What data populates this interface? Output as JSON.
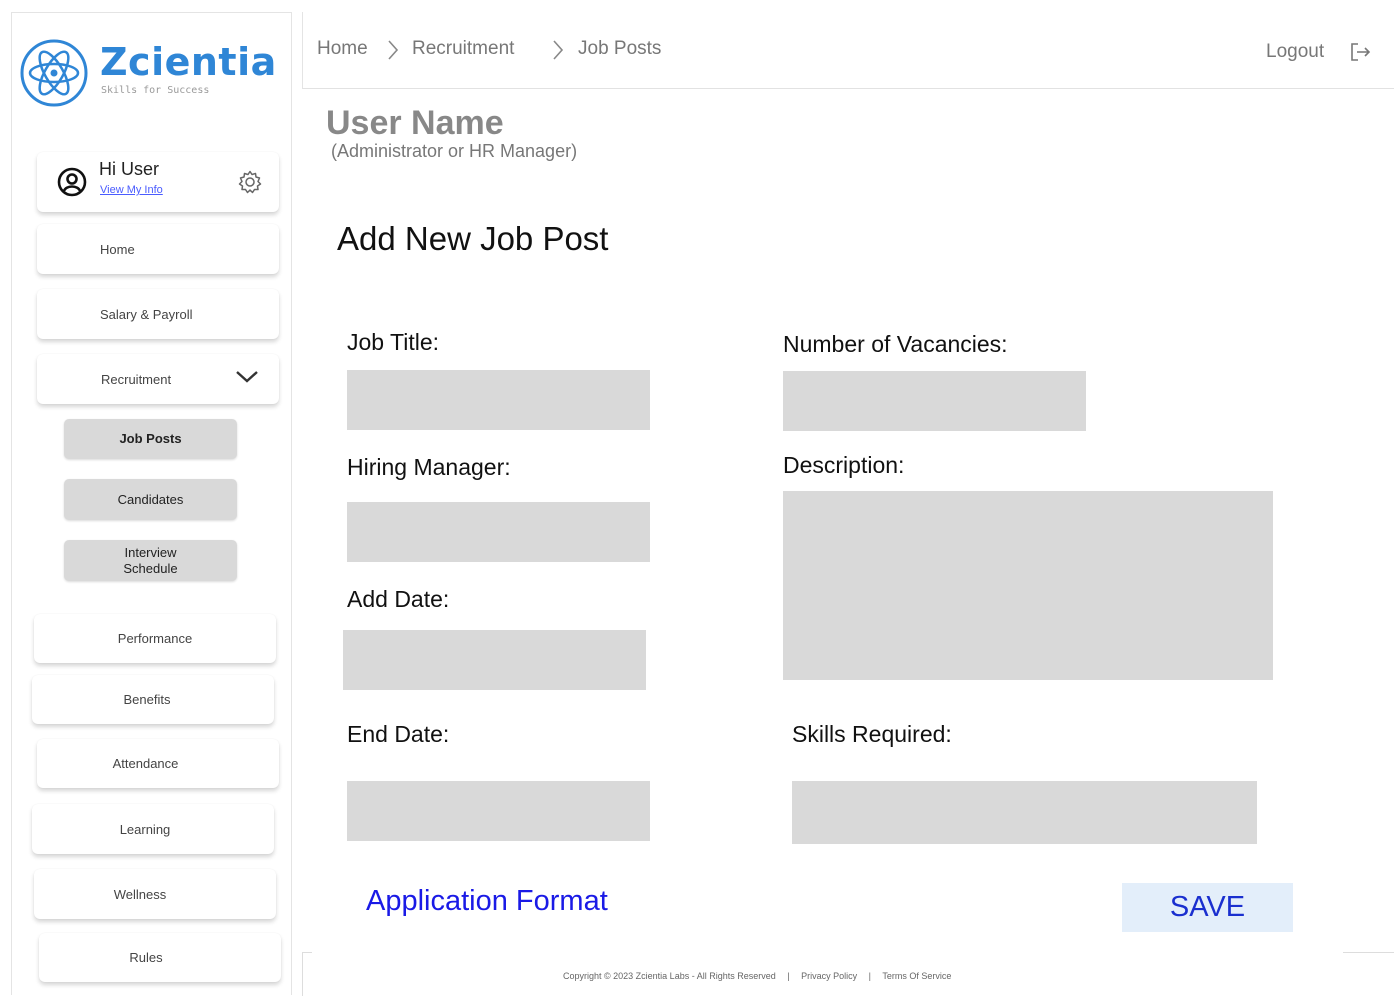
{
  "brand": {
    "name": "Zcientia",
    "tagline": "Skills for Success"
  },
  "user_card": {
    "greeting": "Hi User",
    "link": "View My Info"
  },
  "sidebar": {
    "home": "Home",
    "salary": "Salary &  Payroll",
    "recruitment": "Recruitment",
    "sub_items": {
      "job_posts": "Job Posts",
      "candidates": "Candidates",
      "interview_line1": "Interview",
      "interview_line2": "Schedule"
    },
    "performance": "Performance",
    "benefits": "Benefits",
    "attendance": "Attendance",
    "learning": "Learning",
    "wellness": "Wellness",
    "rules": "Rules"
  },
  "breadcrumb": [
    "Home",
    "Recruitment",
    "Job Posts"
  ],
  "header": {
    "logout": "Logout"
  },
  "profile": {
    "user_name": "User Name",
    "role": "(Administrator or HR Manager)"
  },
  "form": {
    "title": "Add New Job Post",
    "job_title_label": "Job Title:",
    "vacancies_label": "Number of Vacancies:",
    "hiring_manager_label": "Hiring Manager:",
    "description_label": "Description:",
    "add_date_label": "Add Date:",
    "end_date_label": "End Date:",
    "skills_label": "Skills Required:",
    "application_format": "Application Format",
    "save": "SAVE"
  },
  "footer": {
    "copyright": "Copyright © 2023 Zcientia Labs - All Rights Reserved",
    "privacy": "Privacy Policy",
    "terms": "Terms Of Service",
    "separator": "|"
  },
  "colors": {
    "brand_blue": "#2f86d6",
    "field_gray": "#d9d9d9",
    "link_blue": "#1a1ae6",
    "save_bg": "#e3eefa"
  }
}
